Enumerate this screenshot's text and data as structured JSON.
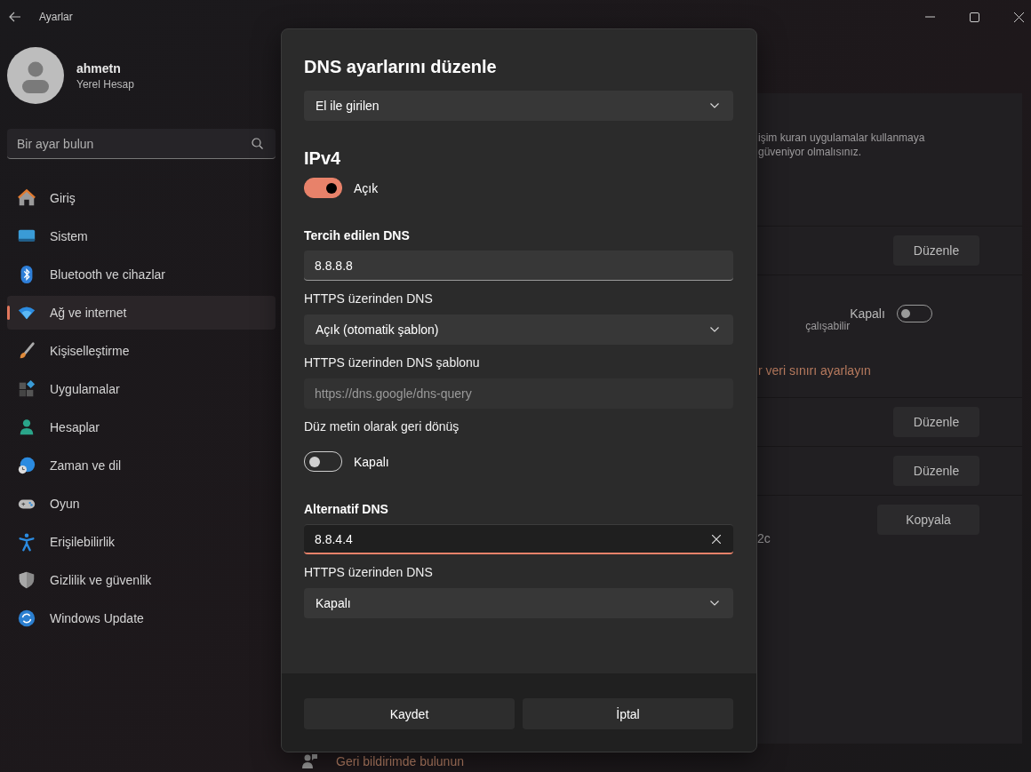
{
  "window": {
    "title": "Ayarlar"
  },
  "account": {
    "name": "ahmetn",
    "type": "Yerel Hesap"
  },
  "search": {
    "placeholder": "Bir ayar bulun"
  },
  "sidebar": {
    "items": [
      {
        "label": "Giriş",
        "selected": false
      },
      {
        "label": "Sistem",
        "selected": false
      },
      {
        "label": "Bluetooth ve cihazlar",
        "selected": false
      },
      {
        "label": "Ağ ve internet",
        "selected": true
      },
      {
        "label": "Kişiselleştirme",
        "selected": false
      },
      {
        "label": "Uygulamalar",
        "selected": false
      },
      {
        "label": "Hesaplar",
        "selected": false
      },
      {
        "label": "Zaman ve dil",
        "selected": false
      },
      {
        "label": "Oyun",
        "selected": false
      },
      {
        "label": "Erişilebilirlik",
        "selected": false
      },
      {
        "label": "Gizlilik ve güvenlik",
        "selected": false
      },
      {
        "label": "Windows Update",
        "selected": false
      }
    ]
  },
  "background_panel": {
    "rows": [
      {
        "kind": "text",
        "lines": [
          "işim kuran uygulamalar kullanmaya",
          "güveniyor olmalısınız."
        ]
      },
      {
        "kind": "button",
        "button": "Düzenle"
      },
      {
        "kind": "toggle",
        "description": "çalışabilir",
        "state_label": "Kapalı",
        "on": false,
        "link": "r veri sınırı ayarlayın"
      },
      {
        "kind": "button",
        "button": "Düzenle"
      },
      {
        "kind": "button",
        "button": "Düzenle"
      },
      {
        "kind": "copy",
        "button": "Kopyala",
        "value": "2c"
      }
    ]
  },
  "feedback_link": "Geri bildirimde bulunun",
  "dialog": {
    "title": "DNS ayarlarını düzenle",
    "fields": [
      {
        "kind": "select",
        "value": "El ile girilen"
      },
      {
        "kind": "heading",
        "text": "IPv4"
      },
      {
        "kind": "toggle",
        "label": "Açık",
        "on": true
      },
      {
        "kind": "section",
        "text": "Tercih edilen DNS"
      },
      {
        "kind": "input",
        "value": "8.8.8.8",
        "focused": false,
        "disabled": false
      },
      {
        "kind": "caption",
        "text": "HTTPS üzerinden DNS"
      },
      {
        "kind": "select",
        "value": "Açık (otomatik şablon)"
      },
      {
        "kind": "caption",
        "text": "HTTPS üzerinden DNS şablonu"
      },
      {
        "kind": "input",
        "value": "https://dns.google/dns-query",
        "focused": false,
        "disabled": true
      },
      {
        "kind": "caption",
        "text": "Düz metin olarak geri dönüş"
      },
      {
        "kind": "toggle",
        "label": "Kapalı",
        "on": false
      },
      {
        "kind": "section",
        "text": "Alternatif DNS"
      },
      {
        "kind": "input",
        "value": "8.8.4.4",
        "focused": true,
        "disabled": false
      },
      {
        "kind": "caption",
        "text": "HTTPS üzerinden DNS"
      },
      {
        "kind": "select",
        "value": "Kapalı"
      }
    ],
    "buttons": [
      "Kaydet",
      "İptal"
    ]
  }
}
